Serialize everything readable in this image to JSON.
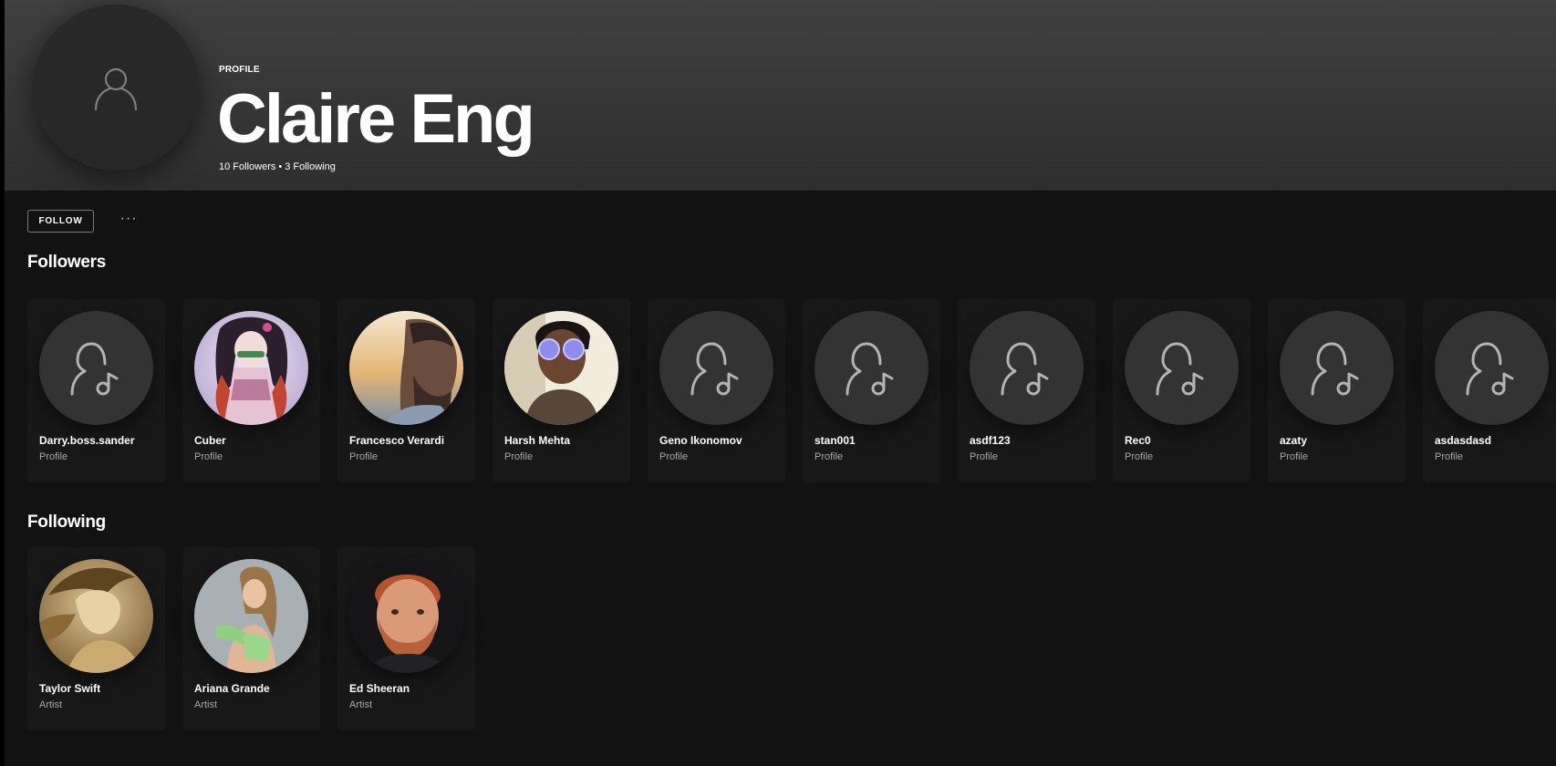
{
  "header": {
    "eyebrow": "PROFILE",
    "title": "Claire Eng",
    "followers_text": "10 Followers",
    "separator": "•",
    "following_text": "3 Following"
  },
  "actions": {
    "follow_label": "FOLLOW",
    "more_label": "···"
  },
  "followers": {
    "title": "Followers",
    "items": [
      {
        "name": "Darry.boss.sander",
        "type": "Profile",
        "avatar": "person-music-icon"
      },
      {
        "name": "Cuber",
        "type": "Profile",
        "avatar": "photo"
      },
      {
        "name": "Francesco Verardi",
        "type": "Profile",
        "avatar": "photo"
      },
      {
        "name": "Harsh Mehta",
        "type": "Profile",
        "avatar": "photo"
      },
      {
        "name": "Geno Ikonomov",
        "type": "Profile",
        "avatar": "person-music-icon"
      },
      {
        "name": "stan001",
        "type": "Profile",
        "avatar": "person-music-icon"
      },
      {
        "name": "asdf123",
        "type": "Profile",
        "avatar": "person-music-icon"
      },
      {
        "name": "Rec0",
        "type": "Profile",
        "avatar": "person-music-icon"
      },
      {
        "name": "azaty",
        "type": "Profile",
        "avatar": "person-music-icon"
      },
      {
        "name": "asdasdasd",
        "type": "Profile",
        "avatar": "person-music-icon"
      }
    ]
  },
  "following": {
    "title": "Following",
    "items": [
      {
        "name": "Taylor Swift",
        "type": "Artist",
        "avatar": "photo"
      },
      {
        "name": "Ariana Grande",
        "type": "Artist",
        "avatar": "photo"
      },
      {
        "name": "Ed Sheeran",
        "type": "Artist",
        "avatar": "photo"
      }
    ]
  },
  "colors": {
    "background": "#121212",
    "card": "#181818",
    "header_top": "#404040",
    "subtext": "#a7a7a7"
  }
}
